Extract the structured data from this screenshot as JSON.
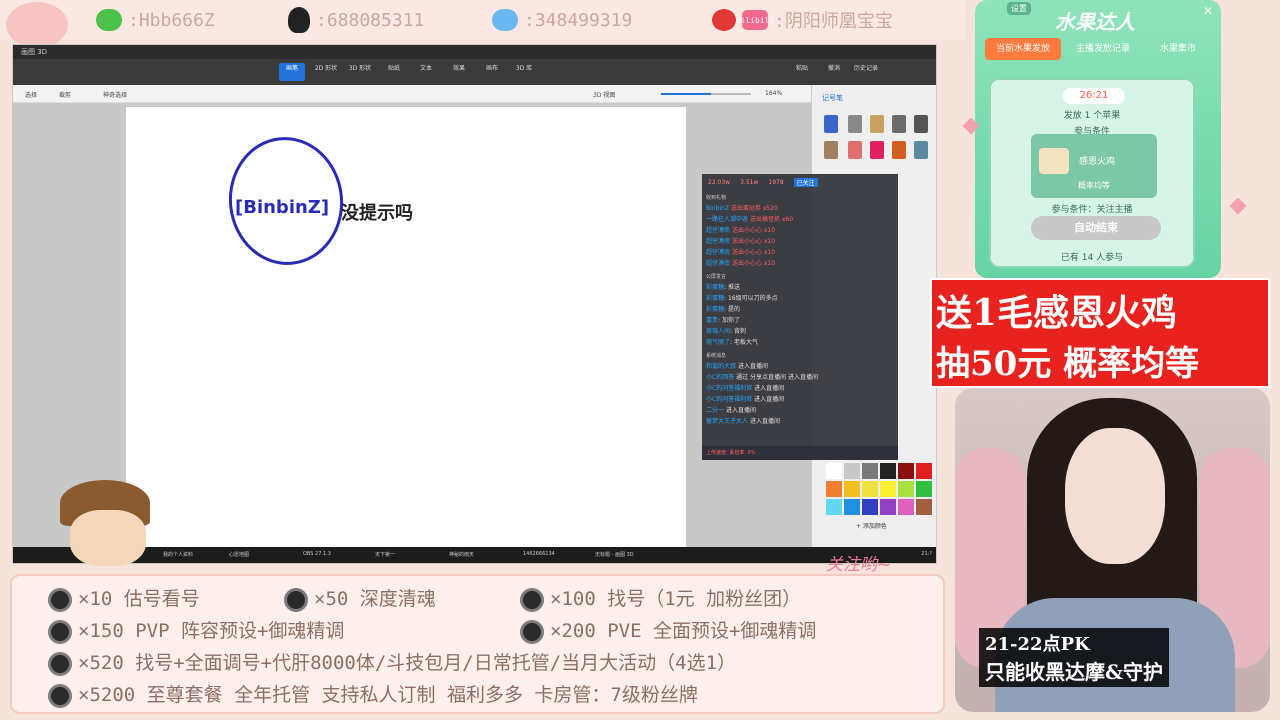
{
  "contacts": {
    "wechat": ":Hbb666Z",
    "qq": ":688085311",
    "qqgroup": ":348499319",
    "weibo": ":阴阳师凰宝宝",
    "bili_icon": "bilibili"
  },
  "paint": {
    "title": "画图 3D",
    "ribbon": [
      "画笔",
      "2D 形状",
      "3D 形状",
      "贴纸",
      "文本",
      "效果",
      "画布",
      "3D 库"
    ],
    "ribbon_right": [
      "粘贴",
      "撤消",
      "历史记录"
    ],
    "sub_left": [
      "选择",
      "裁剪",
      "神奇选择"
    ],
    "sub_right": "3D 视图",
    "zoom": "164%",
    "drawing_label": "[BinbinZ]",
    "drawing_note": "没提示吗",
    "panel_title": "记号笔",
    "add_color": "+ 添加颜色",
    "zoom_value": 0.55
  },
  "chat": {
    "stats": [
      "22.03w",
      "3.51w",
      "1978"
    ],
    "tag": "已关注",
    "gift_title": "收到礼物",
    "gifts": [
      {
        "who": "BinbinZ",
        "text": "送出蛋挞券 x520"
      },
      {
        "who": "一路往人潮中退",
        "text": "送出搞怪抓 x60"
      },
      {
        "who": "超仔溥南",
        "text": "送出小心心 x10"
      },
      {
        "who": "超仔溥南",
        "text": "送出小心心 x10"
      },
      {
        "who": "超仔溥南",
        "text": "送出小心心 x10"
      },
      {
        "who": "超仔溥南",
        "text": "送出小心心 x10"
      }
    ],
    "public_title": "公屏发言",
    "messages": [
      {
        "who": "彩蛋糖",
        "text": "推送"
      },
      {
        "who": "彩蛋糖",
        "text": "16级可以刀的多点"
      },
      {
        "who": "彩蛋糖",
        "text": "是的"
      },
      {
        "who": "富贵",
        "text": "加你了"
      },
      {
        "who": "琉璃人间",
        "text": "背刺"
      },
      {
        "who": "丽气丽了",
        "text": "老板大气"
      }
    ],
    "system_title": "系统消息",
    "system": [
      {
        "who": "和谐的大叔",
        "text": "进入直播间"
      },
      {
        "who": "小C的回答",
        "text": "通过 分享点直播间 进入直播间"
      },
      {
        "who": "小C的问答福利官",
        "text": "进入直播间"
      },
      {
        "who": "小C的问答福利官",
        "text": "进入直播间"
      },
      {
        "who": "二分一",
        "text": "进入直播间"
      },
      {
        "who": "留梦大王子大人",
        "text": "进入直播间"
      }
    ],
    "footer": "上传速度: 丢包率: 0%"
  },
  "taskbar": [
    "我的个人资料",
    "心愿地图",
    "OBS 27.1.3",
    "天下第一",
    "神秘的雨天",
    "1462666134",
    "无标题 - 画图 3D"
  ],
  "taskbar_time": "21:?",
  "prices": [
    [
      {
        "label": "×10 估号看号"
      },
      {
        "label": "×50 深度清魂"
      },
      {
        "label": "×100 找号（1元 加粉丝团）"
      }
    ],
    [
      {
        "label": "×150 PVP 阵容预设+御魂精调"
      },
      {
        "label": "×200 PVE 全面预设+御魂精调"
      }
    ],
    [
      {
        "label": "×520 找号+全面调号+代肝8000体/斗技包月/日常托管/当月大活动（4选1）"
      }
    ],
    [
      {
        "label": "×5200 至尊套餐 全年托管 支持私人订制 福利多多 卡房管：7级粉丝牌"
      }
    ]
  ],
  "follow": "关注哟~",
  "fruit": {
    "title": "水果达人",
    "settings": "设置",
    "tabs": [
      "当前水果发放",
      "主播发放记录",
      "水果集市"
    ],
    "timer": "26:21",
    "issue": "发放 1 个苹果",
    "cond_title": "参与条件",
    "prize": "感恩火鸡",
    "rate": "概率均等",
    "cond": "参与条件：关注主播",
    "button": "自动结束",
    "count": "已有 14 人参与"
  },
  "promo": {
    "line1": "送1毛感恩火鸡",
    "line2": "抽50元 概率均等"
  },
  "pk": {
    "line1": "21-22点PK",
    "line2": "只能收黑达摩&守护"
  },
  "colors": {
    "accent": "#2372d9",
    "promo_red": "#e8231f",
    "pen_blue": "#2a2ab8"
  }
}
